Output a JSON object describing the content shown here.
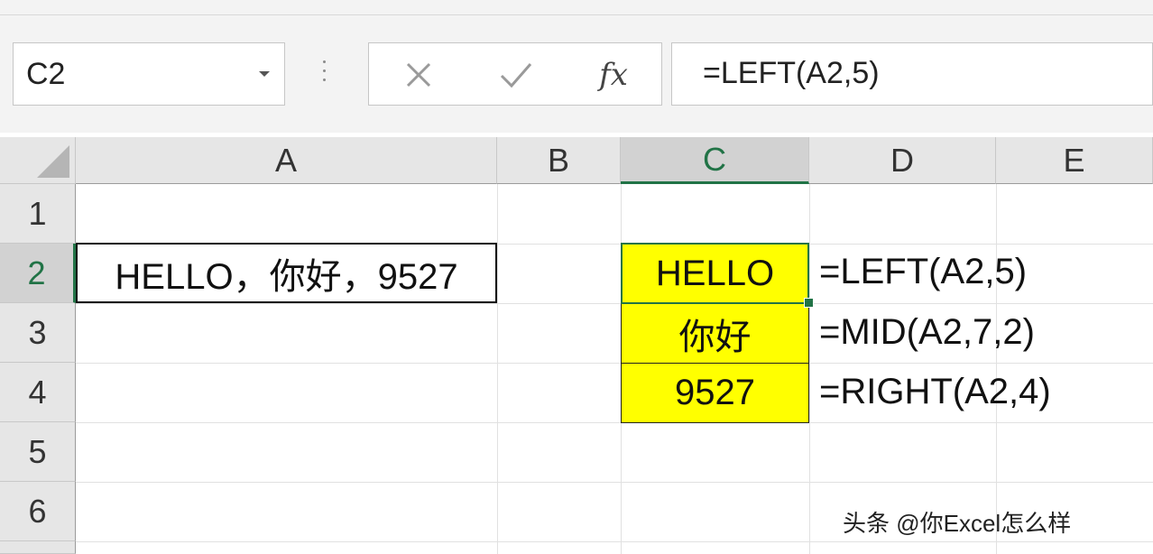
{
  "name_box": {
    "value": "C2"
  },
  "formula_bar": {
    "formula": "=LEFT(A2,5)",
    "fx_label": "fx"
  },
  "columns": [
    "A",
    "B",
    "C",
    "D",
    "E"
  ],
  "rows": [
    "1",
    "2",
    "3",
    "4",
    "5",
    "6"
  ],
  "cells": {
    "A2": "HELLO，你好，9527",
    "C2": "HELLO",
    "C3": "你好",
    "C4": "9527"
  },
  "formula_notes": {
    "D2": "=LEFT(A2,5)",
    "D3": "=MID(A2,7,2)",
    "D4": "=RIGHT(A2,4)"
  },
  "watermark": "头条 @你Excel怎么样",
  "colors": {
    "highlight": "#ffff00",
    "accent": "#217346"
  }
}
